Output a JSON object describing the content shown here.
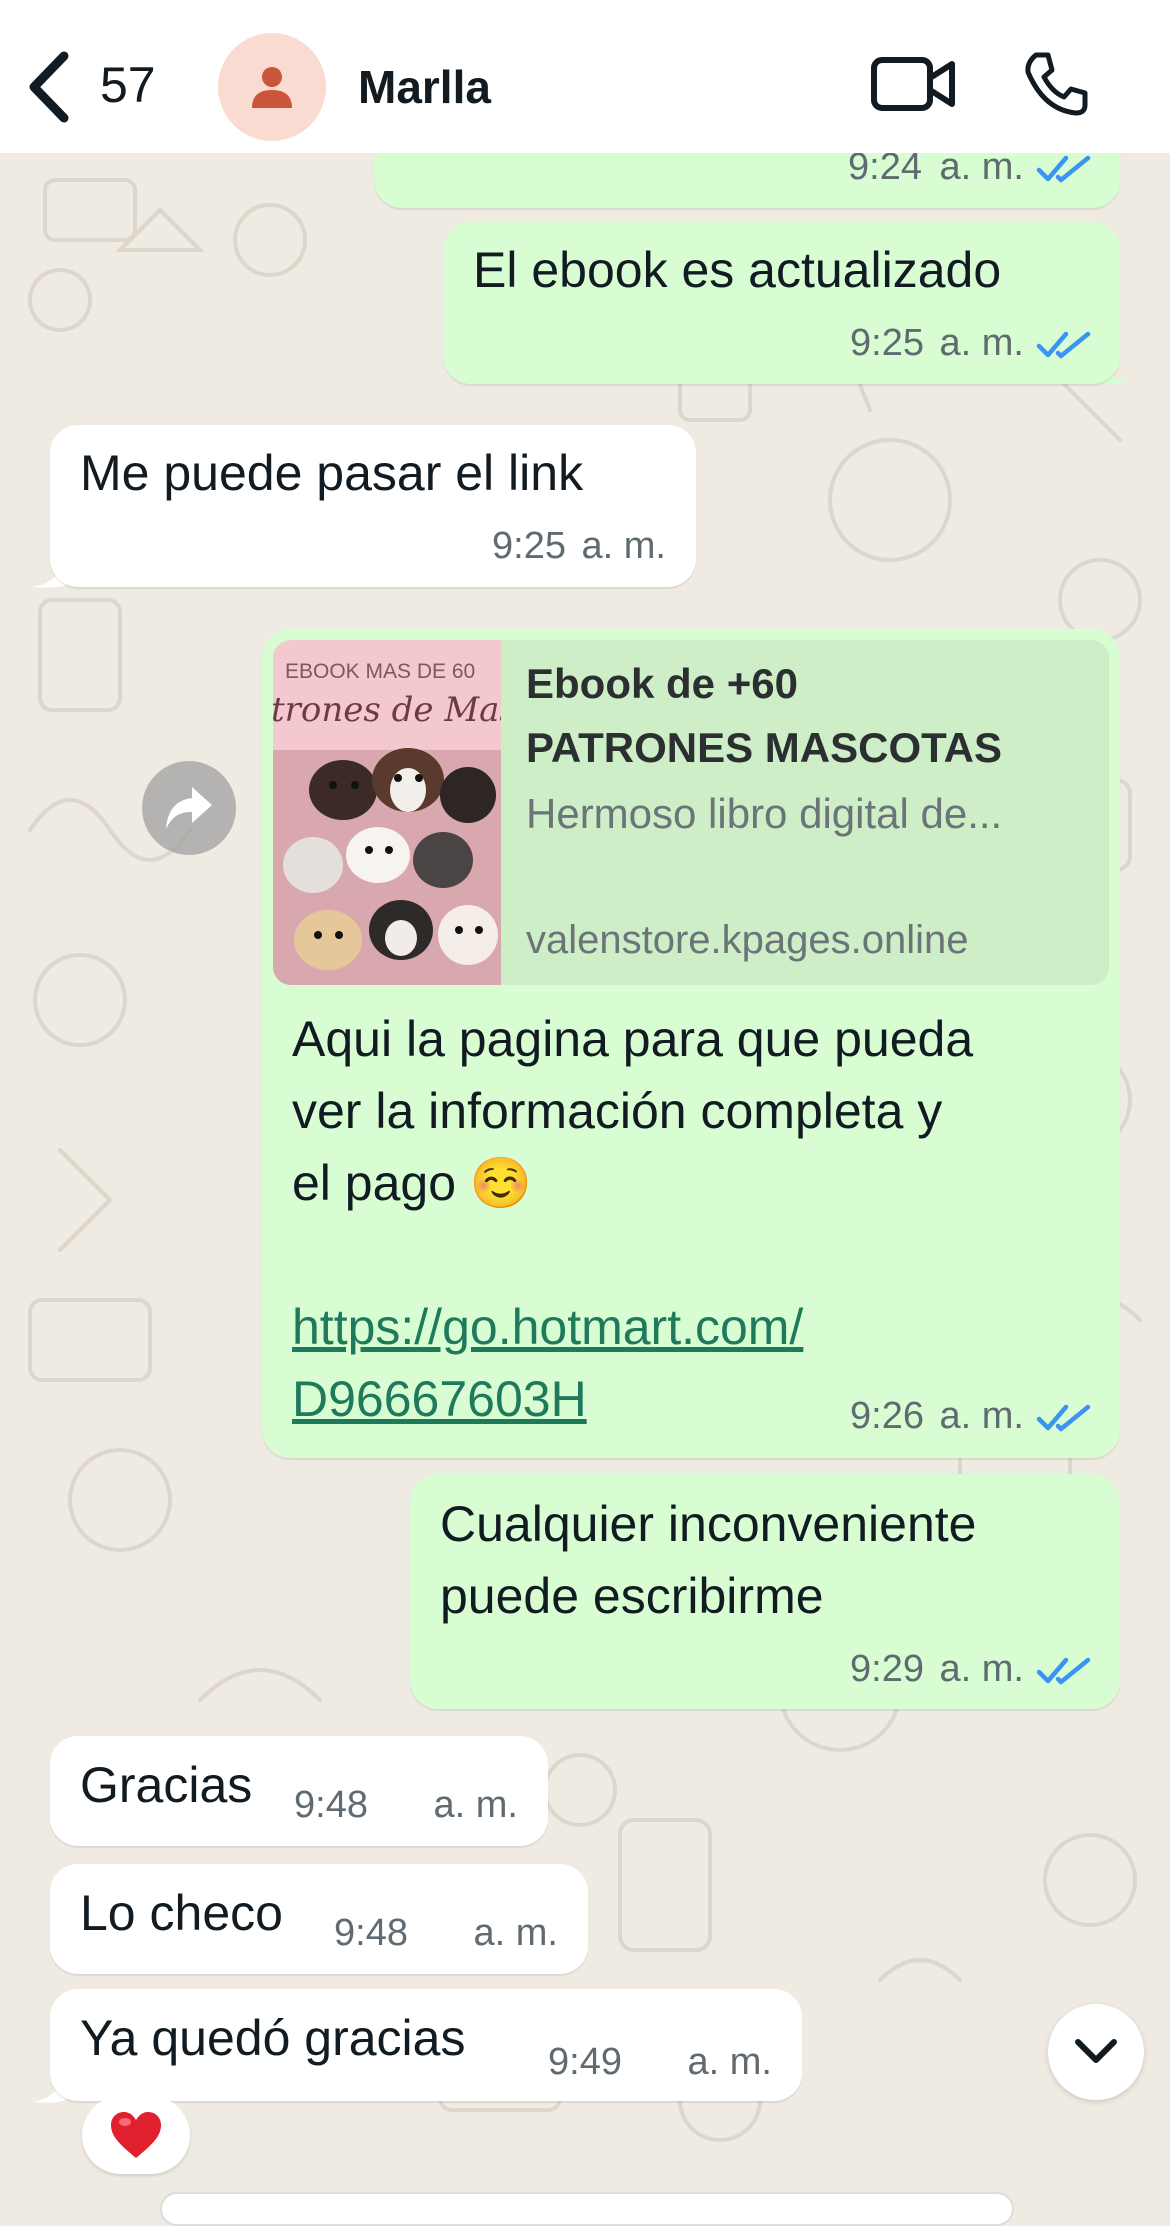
{
  "header": {
    "back_count": "57",
    "contact_name": "Marlla",
    "icons": [
      "chevron-left-icon",
      "person-icon",
      "video-call-icon",
      "phone-icon"
    ]
  },
  "messages": [
    {
      "direction": "out",
      "text": "",
      "time": "9:24",
      "ampm": "a. m.",
      "status": "read"
    },
    {
      "direction": "out",
      "text": "El ebook es actualizado",
      "time": "9:25",
      "ampm": "a. m.",
      "status": "read"
    },
    {
      "direction": "in",
      "text": "Me puede pasar el link",
      "time": "9:25",
      "ampm": "a. m."
    },
    {
      "direction": "out",
      "link_preview": {
        "thumbnail_top_text": "EBOOK MAS DE 60",
        "thumbnail_script_text": "trones de Mascot",
        "title_line1": "Ebook de +60",
        "title_line2": "PATRONES MASCOTAS",
        "description": "Hermoso libro digital de...",
        "domain": "valenstore.kpages.online"
      },
      "text_lines": [
        "Aqui la pagina para que pueda",
        "ver la información completa y",
        "el pago ☺️"
      ],
      "link_lines": [
        "https://go.hotmart.com/",
        "D96667603H"
      ],
      "time": "9:26",
      "ampm": "a. m.",
      "status": "read"
    },
    {
      "direction": "out",
      "text_lines": [
        "Cualquier inconveniente",
        "puede escribirme"
      ],
      "time": "9:29",
      "ampm": "a. m.",
      "status": "read"
    },
    {
      "direction": "in",
      "text": "Gracias",
      "time": "9:48",
      "ampm": "a. m."
    },
    {
      "direction": "in",
      "text": "Lo checo",
      "time": "9:48",
      "ampm": "a. m."
    },
    {
      "direction": "in",
      "text": "Ya quedó gracias",
      "time": "9:49",
      "ampm": "a. m.",
      "reaction": "heart"
    }
  ],
  "colors": {
    "chat_background": "#efeae2",
    "outgoing_bubble": "#d9fdd3",
    "incoming_bubble": "#ffffff",
    "read_ticks": "#3b93f2",
    "link": "#1f7a5c",
    "avatar_bg": "#fadbd2",
    "avatar_fg": "#c9553a"
  }
}
